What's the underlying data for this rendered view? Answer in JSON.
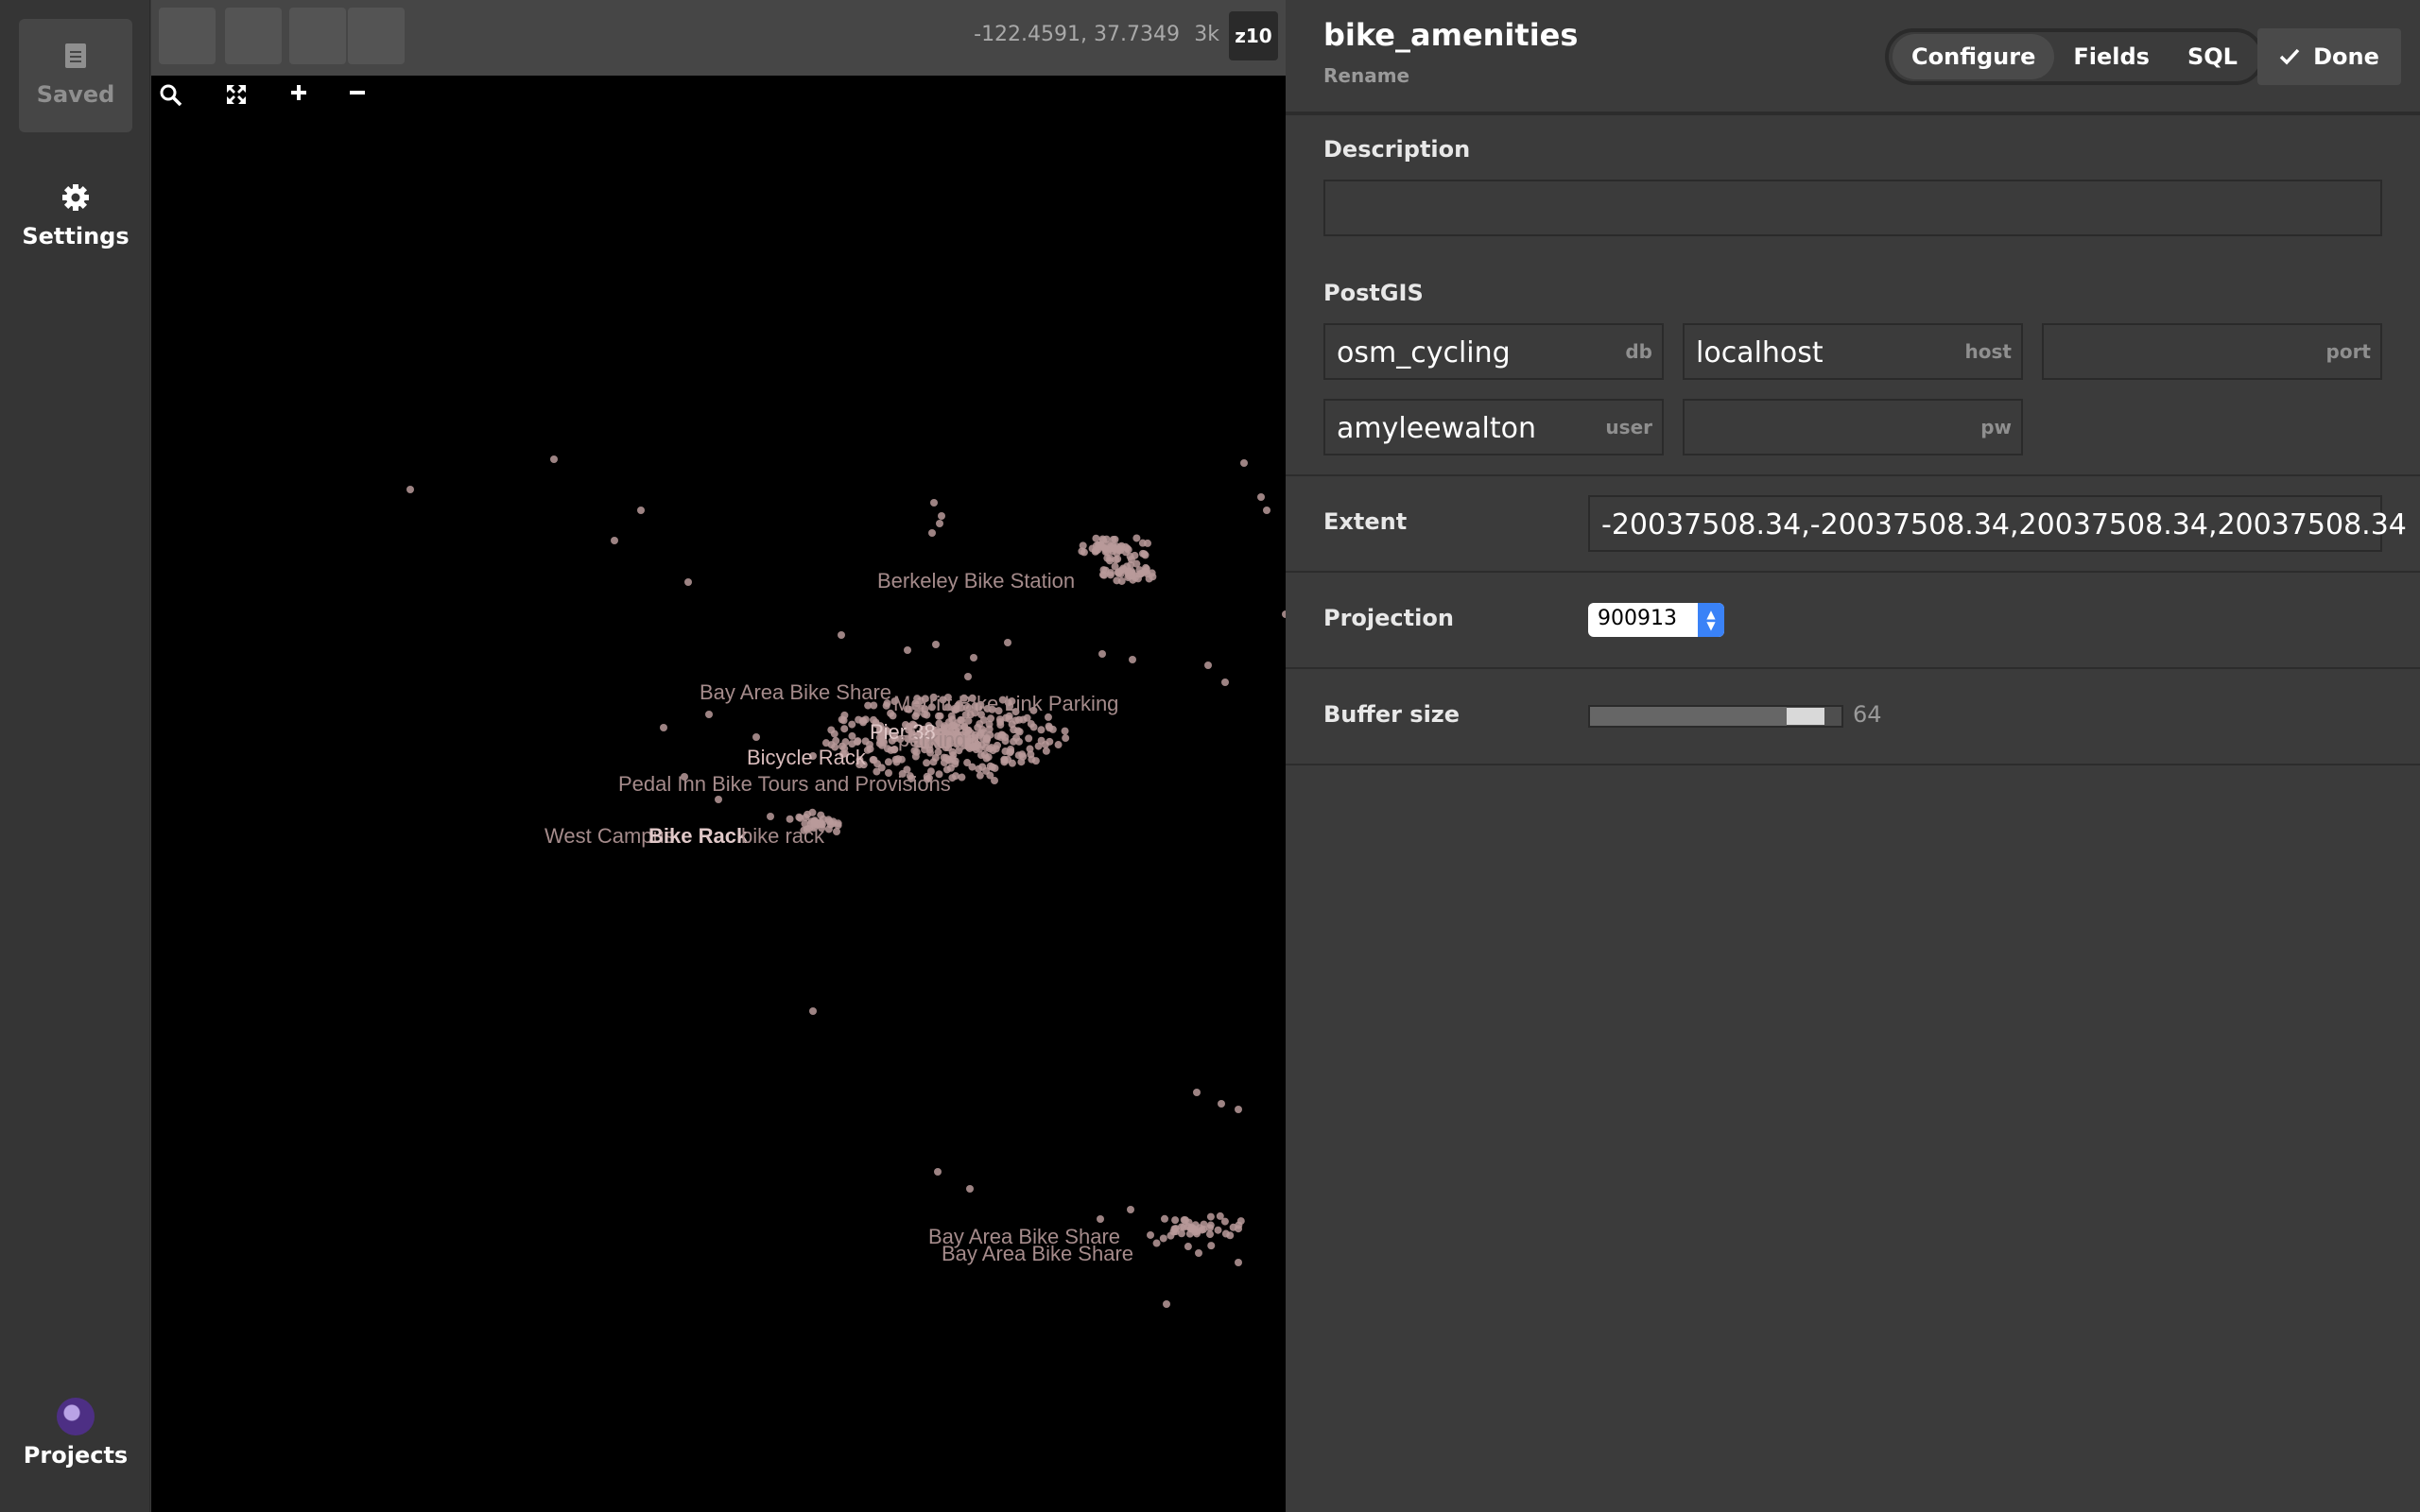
{
  "rail": {
    "saved_label": "Saved",
    "settings_label": "Settings",
    "projects_label": "Projects"
  },
  "map": {
    "coords": "-122.4591, 37.7349",
    "scale": "3k",
    "zoom": "z10",
    "labels": [
      "Berkeley Bike Station",
      "Bay Area Bike Share",
      "Merritt Bike Link Parking",
      "Pier 38",
      "parking",
      "Bicycle Rack",
      "Pedal Inn Bike Tours and Provisions",
      "West Campus",
      "Bike Rack",
      "bike rack",
      "Bay Area Bike Share",
      "Bay Area Bike Share"
    ],
    "point_color": "#b89a9a"
  },
  "panel": {
    "layer_name": "bike_amenities",
    "rename_label": "Rename",
    "tabs": [
      "Configure",
      "Fields",
      "SQL"
    ],
    "active_tab": "Configure",
    "done_label": "Done",
    "description_label": "Description",
    "description_value": "",
    "postgis_label": "PostGIS",
    "db": {
      "value": "osm_cycling",
      "tag": "db"
    },
    "host": {
      "value": "localhost",
      "tag": "host"
    },
    "port": {
      "value": "",
      "tag": "port"
    },
    "user": {
      "value": "amyleewalton",
      "tag": "user"
    },
    "pw": {
      "value": "",
      "tag": "pw"
    },
    "extent_label": "Extent",
    "extent_value": "-20037508.34,-20037508.34,20037508.34,20037508.34",
    "projection_label": "Projection",
    "projection_value": "900913",
    "buffer_label": "Buffer size",
    "buffer_value": "64",
    "buffer_fraction": 0.92
  }
}
